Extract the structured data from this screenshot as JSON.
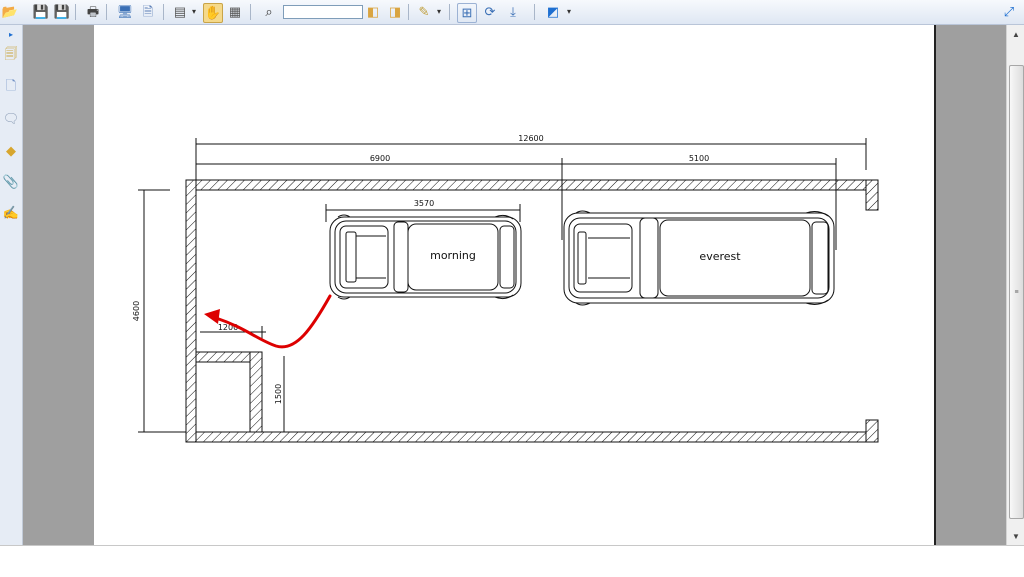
{
  "toolbar": {
    "find_value": "",
    "buttons": [
      {
        "name": "open-folder-icon",
        "glyph": "📂",
        "color": "#e8a21a"
      },
      {
        "name": "save-icon",
        "glyph": "💾",
        "color": "#3a5f9e"
      },
      {
        "name": "save-all-icon",
        "glyph": "💾",
        "color": "#3a5f9e"
      },
      {
        "name": "print-icon",
        "glyph": "🖶",
        "color": "#444444"
      },
      {
        "name": "email-icon",
        "glyph": "🖥",
        "color": "#3a6fb5"
      },
      {
        "name": "document-properties-icon",
        "glyph": "🗎",
        "color": "#5a7db5"
      },
      {
        "name": "page-layout-icon",
        "glyph": "▤",
        "color": "#555555"
      },
      {
        "name": "hand-tool-icon",
        "glyph": "✋",
        "color": "#d9a441"
      },
      {
        "name": "select-text-icon",
        "glyph": "▦",
        "color": "#555555"
      },
      {
        "name": "find-binoculars-icon",
        "glyph": "⌕",
        "color": "#333333"
      },
      {
        "name": "find-previous-icon",
        "glyph": "◧",
        "color": "#d9a441"
      },
      {
        "name": "find-next-icon",
        "glyph": "◨",
        "color": "#d9a441"
      },
      {
        "name": "highlight-icon",
        "glyph": "✎",
        "color": "#c0a040"
      },
      {
        "name": "zoom-icon",
        "glyph": "⊞",
        "color": "#3a6fb5"
      },
      {
        "name": "rotate-icon",
        "glyph": "⟳",
        "color": "#3a6fb5"
      },
      {
        "name": "fit-page-icon",
        "glyph": "⤓",
        "color": "#3a6fb5"
      },
      {
        "name": "extension-icon",
        "glyph": "◩",
        "color": "#1e6fd1"
      },
      {
        "name": "maximize-icon",
        "glyph": "⤢",
        "color": "#1e6fd1"
      }
    ]
  },
  "left_rail": {
    "items": [
      {
        "name": "collapse-arrow-icon",
        "glyph": "▸",
        "color": "#1e6fd1"
      },
      {
        "name": "bookmarks-icon",
        "glyph": "🗐",
        "color": "#c9a43a"
      },
      {
        "name": "pages-icon",
        "glyph": "🗋",
        "color": "#6f8fc4"
      },
      {
        "name": "comments-icon",
        "glyph": "🗨",
        "color": "#8fa0b8"
      },
      {
        "name": "layers-icon",
        "glyph": "◆",
        "color": "#d7a62e"
      },
      {
        "name": "attachments-icon",
        "glyph": "📎",
        "color": "#5a6f8f"
      },
      {
        "name": "signatures-icon",
        "glyph": "✍",
        "color": "#6a6a6a"
      }
    ]
  },
  "scrollbar": {
    "up": "▲",
    "down": "▼",
    "thumb_grip": "≡"
  },
  "drawing": {
    "dimensions": {
      "overall_width": "12600",
      "left_bay": "6900",
      "right_bay": "5100",
      "car_length": "3570",
      "depth": "4600",
      "door_offset": "1200",
      "storage_depth": "1500"
    },
    "cars": {
      "left": "morning",
      "right": "everest"
    },
    "colors": {
      "arrow": "#dd0000",
      "ink": "#111111"
    }
  }
}
